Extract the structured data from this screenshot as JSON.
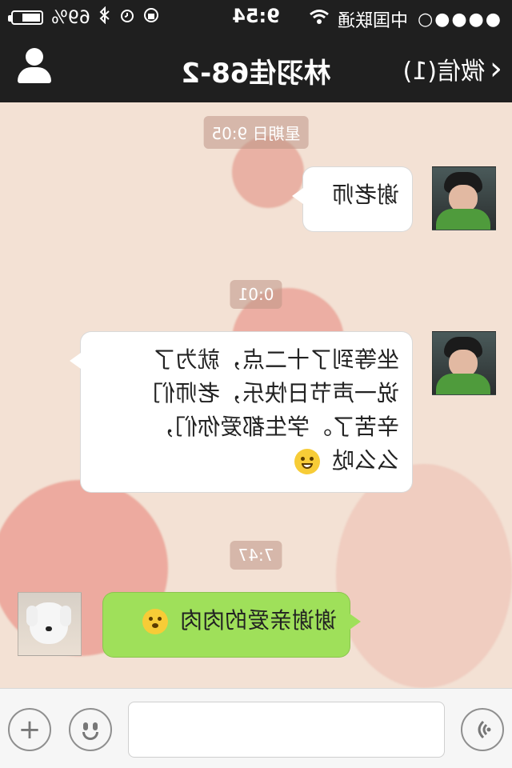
{
  "status_bar": {
    "signal_dots": "●●●●○",
    "carrier": "中国联通",
    "wifi_icon": "wifi-icon",
    "time": "9:54",
    "battery_percent": "69%",
    "battery_level": 0.69
  },
  "nav": {
    "back_label": "微信(1)",
    "title": "林羽佳68-2",
    "profile_icon": "person-icon"
  },
  "messages": [
    {
      "timestamp": "星期日 9:05"
    },
    {
      "side": "right",
      "avatar": "boy-photo",
      "text": "谢老师"
    },
    {
      "timestamp": "0:01"
    },
    {
      "side": "right",
      "avatar": "boy-photo",
      "lines": [
        "坐等到了十二点，就为了",
        "说一声节日快乐，老师们",
        "辛苦了。学生都爱你们，",
        "么么哒"
      ],
      "emoji": "grinning-emoji"
    },
    {
      "timestamp": "7:47"
    },
    {
      "side": "left",
      "avatar": "dog-photo",
      "text": "谢谢亲爱的肉肉",
      "emoji": "kissing-emoji"
    }
  ],
  "input_bar": {
    "placeholder": "",
    "voice_icon": "voice-icon",
    "emoji_icon": "emoji-icon",
    "plus_icon": "plus-icon"
  },
  "colors": {
    "header_bg": "#1f1f1f",
    "chat_bg": "#f3e1d4",
    "sent_bubble": "#ffffff",
    "received_bubble": "#9fe05a"
  }
}
